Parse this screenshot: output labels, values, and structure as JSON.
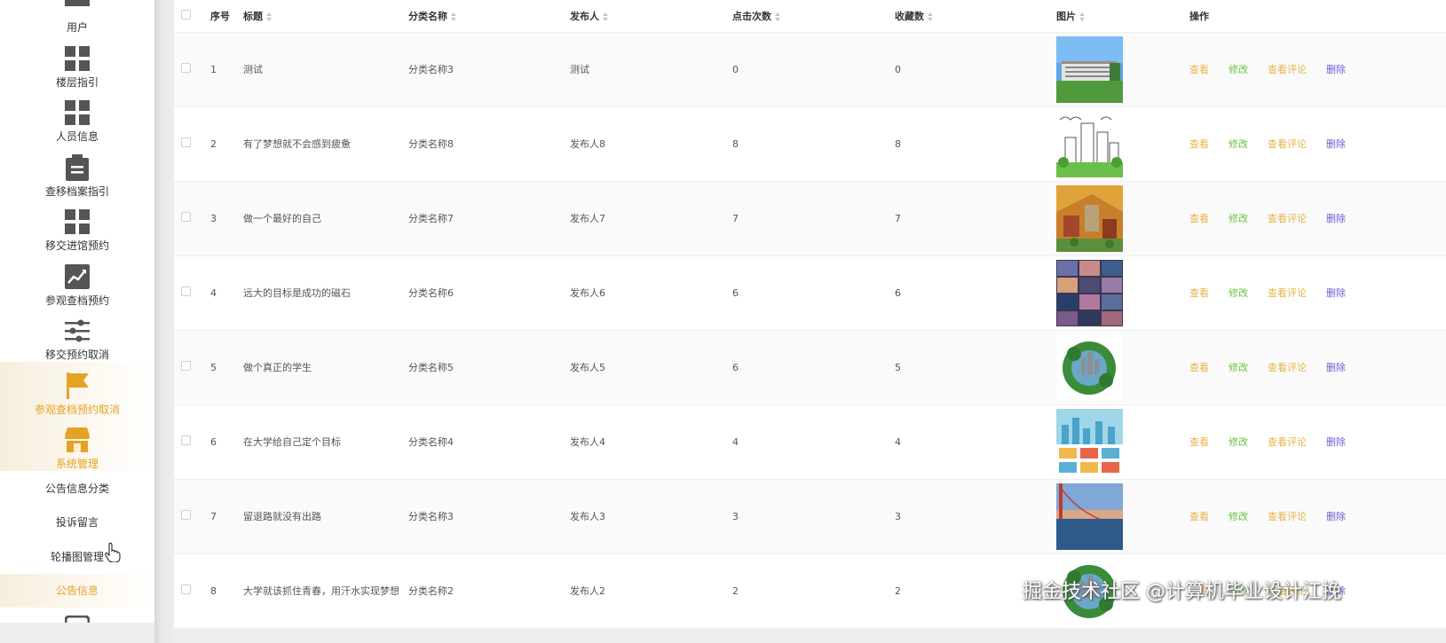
{
  "sidebar": {
    "items": [
      {
        "label": "用户",
        "icon": "grid-icon"
      },
      {
        "label": "楼层指引",
        "icon": "grid-icon"
      },
      {
        "label": "人员信息",
        "icon": "grid-icon"
      },
      {
        "label": "查移档案指引",
        "icon": "clipboard-icon"
      },
      {
        "label": "移交进馆预约",
        "icon": "grid-icon"
      },
      {
        "label": "参观查档预约",
        "icon": "chart-icon"
      },
      {
        "label": "移交预约取消",
        "icon": "sliders-icon"
      },
      {
        "label": "参观查档预约取消",
        "icon": "flag-icon"
      },
      {
        "label": "系统管理",
        "icon": "store-icon"
      }
    ],
    "sub_items": [
      {
        "label": "公告信息分类"
      },
      {
        "label": "投诉留言"
      },
      {
        "label": "轮播图管理"
      },
      {
        "label": "公告信息"
      }
    ]
  },
  "table": {
    "headers": {
      "index": "序号",
      "title": "标题",
      "category": "分类名称",
      "publisher": "发布人",
      "clicks": "点击次数",
      "favorites": "收藏数",
      "image": "图片",
      "actions": "操作"
    },
    "action_labels": {
      "view": "查看",
      "edit": "修改",
      "comments": "查看评论",
      "delete": "删除"
    },
    "rows": [
      {
        "index": "1",
        "title": "测试",
        "category": "分类名称3",
        "publisher": "测试",
        "clicks": "0",
        "favorites": "0",
        "image": "campus-building"
      },
      {
        "index": "2",
        "title": "有了梦想就不会感到疲惫",
        "category": "分类名称8",
        "publisher": "发布人8",
        "clicks": "8",
        "favorites": "8",
        "image": "sketch-city"
      },
      {
        "index": "3",
        "title": "做一个最好的自己",
        "category": "分类名称7",
        "publisher": "发布人7",
        "clicks": "7",
        "favorites": "7",
        "image": "isometric-town"
      },
      {
        "index": "4",
        "title": "远大的目标是成功的磁石",
        "category": "分类名称6",
        "publisher": "发布人6",
        "clicks": "6",
        "favorites": "6",
        "image": "city-collage"
      },
      {
        "index": "5",
        "title": "做个真正的学生",
        "category": "分类名称5",
        "publisher": "发布人5",
        "clicks": "6",
        "favorites": "5",
        "image": "green-globe"
      },
      {
        "index": "6",
        "title": "在大学给自己定个目标",
        "category": "分类名称4",
        "publisher": "发布人4",
        "clicks": "4",
        "favorites": "4",
        "image": "flat-city"
      },
      {
        "index": "7",
        "title": "留退路就没有出路",
        "category": "分类名称3",
        "publisher": "发布人3",
        "clicks": "3",
        "favorites": "3",
        "image": "bridge-sea"
      },
      {
        "index": "8",
        "title": "大学就该抓住青春，用汗水实现梦想",
        "category": "分类名称2",
        "publisher": "发布人2",
        "clicks": "2",
        "favorites": "2",
        "image": "green-globe"
      }
    ]
  },
  "watermark": "掘金技术社区 @计算机毕业设计江挽",
  "colors": {
    "accent": "#e5a324",
    "view": "#e6b44a",
    "edit": "#67c23a",
    "delete": "#6b5fd6"
  }
}
